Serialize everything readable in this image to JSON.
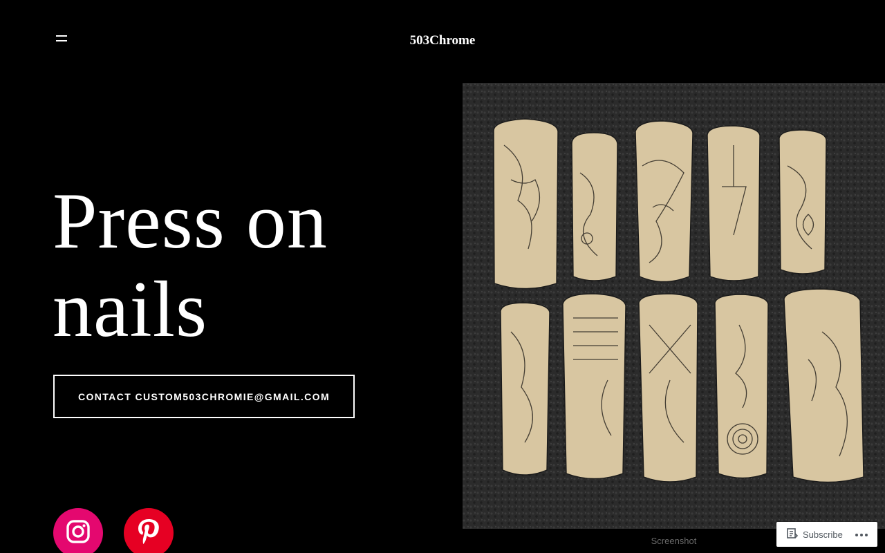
{
  "header": {
    "menu_icon": "menu-icon",
    "site_title": "503Chrome"
  },
  "hero": {
    "title": "Press on nails",
    "contact_label": "CONTACT CUSTOM503CHROMIE@GMAIL.COM"
  },
  "social": [
    {
      "name": "Instagram",
      "icon": "instagram-icon",
      "color": "#e4086f"
    },
    {
      "name": "Pinterest",
      "icon": "pinterest-icon",
      "color": "#e60023"
    }
  ],
  "image": {
    "caption": "Screenshot"
  },
  "actionbar": {
    "subscribe_label": "Subscribe",
    "more_icon": "more-horizontal-icon"
  }
}
